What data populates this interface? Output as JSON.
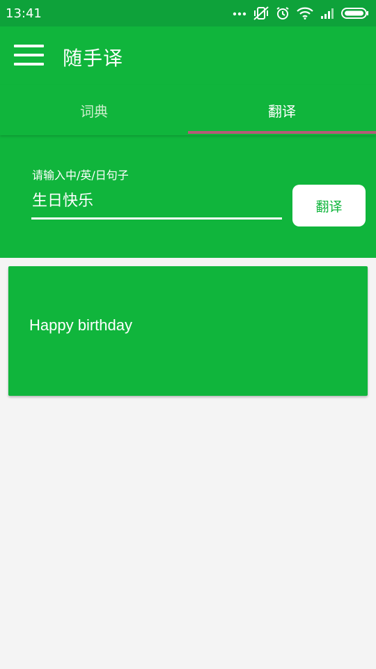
{
  "status_bar": {
    "time": "13:41",
    "icons": [
      "more-dots-icon",
      "vibrate-mute-icon",
      "alarm-icon",
      "wifi-icon",
      "signal-icon",
      "battery-icon"
    ]
  },
  "app_bar": {
    "title": "随手译",
    "menu_icon": "hamburger-menu-icon"
  },
  "tabs": [
    {
      "label": "词典",
      "active": false
    },
    {
      "label": "翻译",
      "active": true
    }
  ],
  "translate_form": {
    "label": "请输入中/英/日句子",
    "input_value": "生日快乐",
    "button_label": "翻译"
  },
  "result": {
    "text": "Happy birthday"
  },
  "colors": {
    "primary": "#10b53c",
    "status_bar": "#0ea23a",
    "tab_indicator": "#b65a78",
    "background": "#f4f4f4"
  }
}
